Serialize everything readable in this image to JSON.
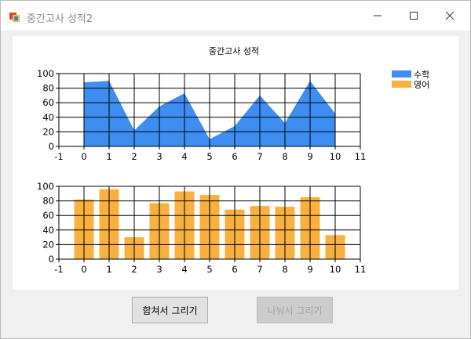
{
  "window": {
    "title": "중간고사 성적2"
  },
  "buttons": {
    "combine": "합쳐서 그리기",
    "split": "나눠서 그리기"
  },
  "colors": {
    "math": "#3d8ef0",
    "english": "#f8b03e"
  },
  "chart_data": [
    {
      "type": "area",
      "title": "중간고사 성적",
      "x": [
        0,
        1,
        2,
        3,
        4,
        5,
        6,
        7,
        8,
        9,
        10
      ],
      "series": [
        {
          "name": "수학",
          "values": [
            88,
            90,
            22,
            55,
            73,
            10,
            28,
            70,
            32,
            90,
            45
          ]
        }
      ],
      "xlim": [
        -1,
        11
      ],
      "ylim": [
        0,
        100
      ],
      "xticks": [
        -1,
        0,
        1,
        2,
        3,
        4,
        5,
        6,
        7,
        8,
        9,
        10,
        11
      ],
      "yticks": [
        0,
        20,
        40,
        60,
        80,
        100
      ],
      "grid": true,
      "legend": "top-right"
    },
    {
      "type": "bar",
      "x": [
        0,
        1,
        2,
        3,
        4,
        5,
        6,
        7,
        8,
        9,
        10
      ],
      "series": [
        {
          "name": "영어",
          "values": [
            82,
            96,
            30,
            77,
            93,
            88,
            68,
            73,
            72,
            85,
            33
          ]
        }
      ],
      "xlim": [
        -1,
        11
      ],
      "ylim": [
        0,
        100
      ],
      "xticks": [
        -1,
        0,
        1,
        2,
        3,
        4,
        5,
        6,
        7,
        8,
        9,
        10,
        11
      ],
      "yticks": [
        0,
        20,
        40,
        60,
        80,
        100
      ],
      "grid": true,
      "legend": "top-right"
    }
  ]
}
